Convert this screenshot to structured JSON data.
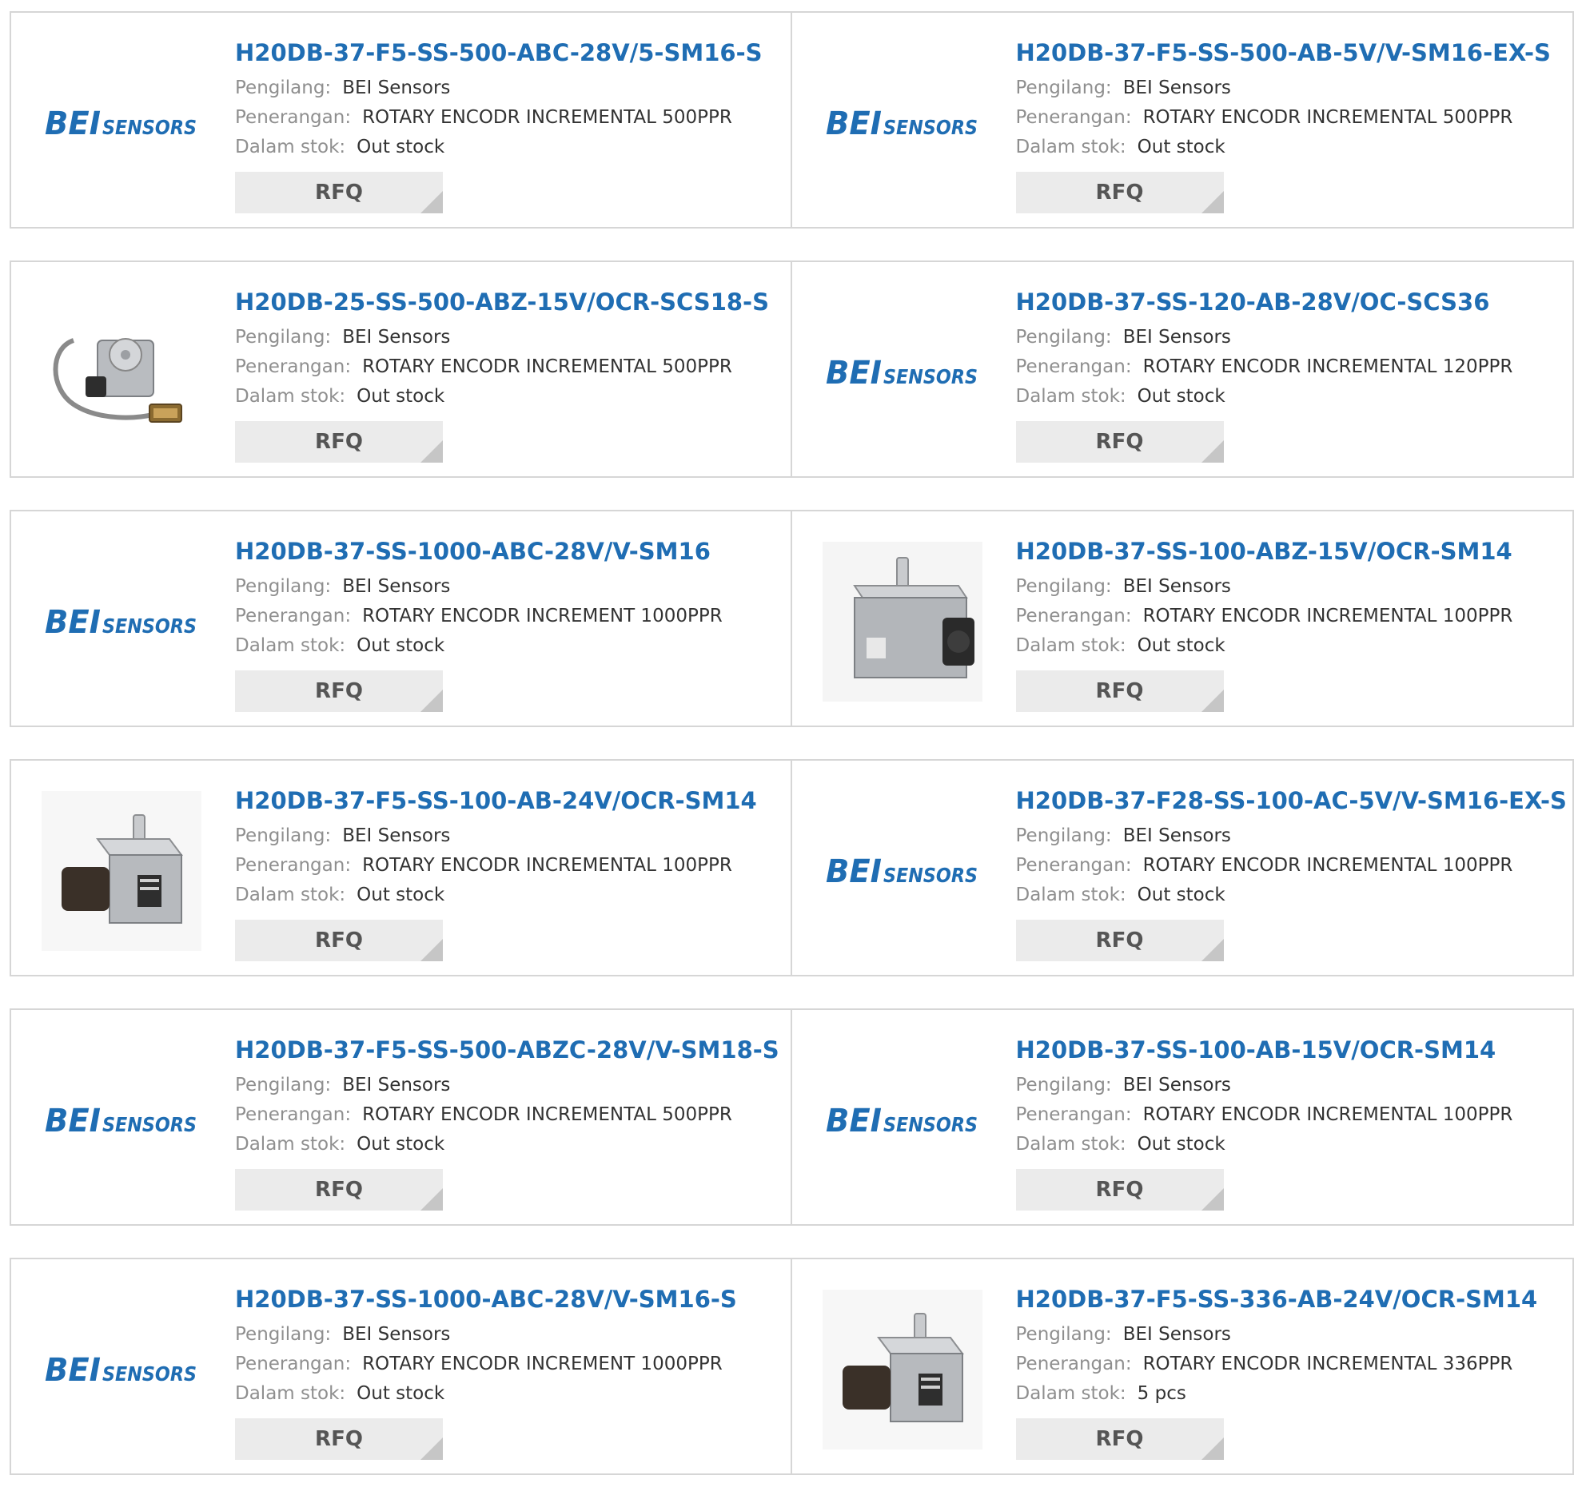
{
  "labels": {
    "manufacturer": "Pengilang:",
    "description": "Penerangan:",
    "stock": "Dalam stok:",
    "rfq": "RFQ"
  },
  "logo": {
    "bei": "BEI",
    "sensors": "SENSORS",
    "color": "#1f6db3"
  },
  "products": [
    {
      "part": "H20DB-37-F5-SS-500-ABC-28V/5-SM16-S",
      "manufacturer": "BEI Sensors",
      "description": "ROTARY ENCODR INCREMENTAL 500PPR",
      "stock": "Out stock",
      "image": "bei-sensors-logo"
    },
    {
      "part": "H20DB-37-F5-SS-500-AB-5V/V-SM16-EX-S",
      "manufacturer": "BEI Sensors",
      "description": "ROTARY ENCODR INCREMENTAL 500PPR",
      "stock": "Out stock",
      "image": "bei-sensors-logo"
    },
    {
      "part": "H20DB-25-SS-500-ABZ-15V/OCR-SCS18-S",
      "manufacturer": "BEI Sensors",
      "description": "ROTARY ENCODR INCREMENTAL 500PPR",
      "stock": "Out stock",
      "image": "encoder-cable-photo"
    },
    {
      "part": "H20DB-37-SS-120-AB-28V/OC-SCS36",
      "manufacturer": "BEI Sensors",
      "description": "ROTARY ENCODR INCREMENTAL 120PPR",
      "stock": "Out stock",
      "image": "bei-sensors-logo"
    },
    {
      "part": "H20DB-37-SS-1000-ABC-28V/V-SM16",
      "manufacturer": "BEI Sensors",
      "description": "ROTARY ENCODR INCREMENT 1000PPR",
      "stock": "Out stock",
      "image": "bei-sensors-logo"
    },
    {
      "part": "H20DB-37-SS-100-ABZ-15V/OCR-SM14",
      "manufacturer": "BEI Sensors",
      "description": "ROTARY ENCODR INCREMENTAL 100PPR",
      "stock": "Out stock",
      "image": "encoder-front-photo"
    },
    {
      "part": "H20DB-37-F5-SS-100-AB-24V/OCR-SM14",
      "manufacturer": "BEI Sensors",
      "description": "ROTARY ENCODR INCREMENTAL 100PPR",
      "stock": "Out stock",
      "image": "encoder-side-photo"
    },
    {
      "part": "H20DB-37-F28-SS-100-AC-5V/V-SM16-EX-S",
      "manufacturer": "BEI Sensors",
      "description": "ROTARY ENCODR INCREMENTAL 100PPR",
      "stock": "Out stock",
      "image": "bei-sensors-logo"
    },
    {
      "part": "H20DB-37-F5-SS-500-ABZC-28V/V-SM18-S",
      "manufacturer": "BEI Sensors",
      "description": "ROTARY ENCODR INCREMENTAL 500PPR",
      "stock": "Out stock",
      "image": "bei-sensors-logo"
    },
    {
      "part": "H20DB-37-SS-100-AB-15V/OCR-SM14",
      "manufacturer": "BEI Sensors",
      "description": "ROTARY ENCODR INCREMENTAL 100PPR",
      "stock": "Out stock",
      "image": "bei-sensors-logo"
    },
    {
      "part": "H20DB-37-SS-1000-ABC-28V/V-SM16-S",
      "manufacturer": "BEI Sensors",
      "description": "ROTARY ENCODR INCREMENT 1000PPR",
      "stock": "Out stock",
      "image": "bei-sensors-logo"
    },
    {
      "part": "H20DB-37-F5-SS-336-AB-24V/OCR-SM14",
      "manufacturer": "BEI Sensors",
      "description": "ROTARY ENCODR INCREMENTAL 336PPR",
      "stock": "5 pcs",
      "image": "encoder-side-photo"
    }
  ]
}
